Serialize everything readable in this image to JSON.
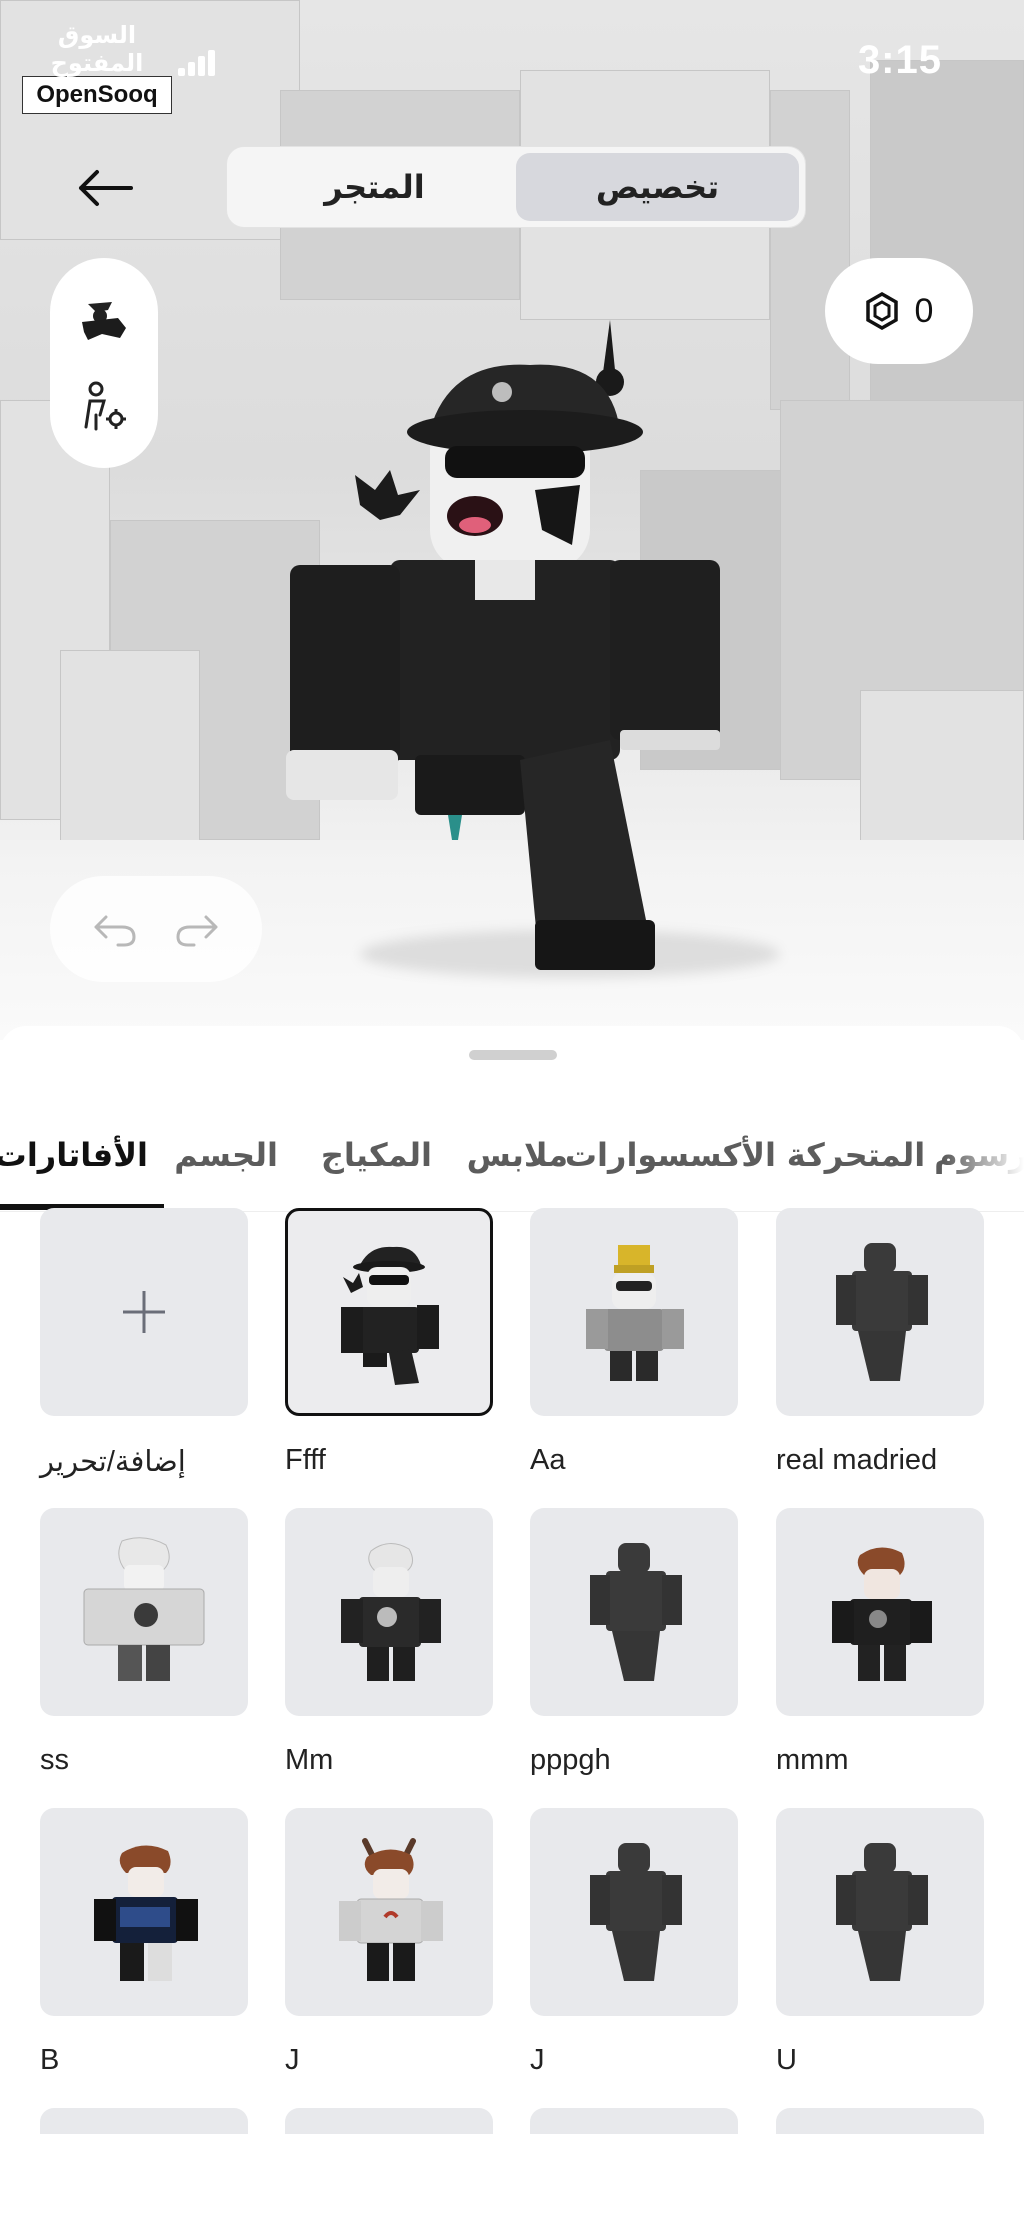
{
  "status_bar": {
    "time": "3:15"
  },
  "watermark": {
    "arabic": "السوق المفتوح",
    "brand": "OpenSooq"
  },
  "header": {
    "segments": [
      {
        "label": "المتجر",
        "active": false
      },
      {
        "label": "تخصيص",
        "active": true
      }
    ]
  },
  "robux": {
    "icon": "robux-icon",
    "count": "0"
  },
  "side_tools": [
    {
      "icon": "avatar-pose-icon"
    },
    {
      "icon": "avatar-settings-icon"
    }
  ],
  "history": {
    "undo_icon": "undo-icon",
    "redo_icon": "redo-icon"
  },
  "category_tabs": [
    {
      "label": "الأفاتارات",
      "active": true
    },
    {
      "label": "الجسم",
      "active": false
    },
    {
      "label": "المكياج",
      "active": false
    },
    {
      "label": "ملابس",
      "active": false
    },
    {
      "label": "الأكسسوارات",
      "active": false
    },
    {
      "label": "الرسوم المتحركة",
      "active": false
    }
  ],
  "outfits": [
    {
      "name": "إضافة/تحرير",
      "kind": "add"
    },
    {
      "name": "Ffff",
      "kind": "cop",
      "selected": true
    },
    {
      "name": "Aa",
      "kind": "crown"
    },
    {
      "name": "real madried",
      "kind": "blank"
    },
    {
      "name": "ss",
      "kind": "white"
    },
    {
      "name": "Mm",
      "kind": "gray"
    },
    {
      "name": "pppgh",
      "kind": "blank"
    },
    {
      "name": "mmm",
      "kind": "brown"
    },
    {
      "name": "B",
      "kind": "blue"
    },
    {
      "name": "J",
      "kind": "horns"
    },
    {
      "name": "J",
      "kind": "blank"
    },
    {
      "name": "U",
      "kind": "blank"
    }
  ],
  "colors": {
    "accent": "#111111",
    "sheet_bg": "#ffffff",
    "thumb_bg": "#e8e9ec",
    "selected_border": "#111111"
  }
}
